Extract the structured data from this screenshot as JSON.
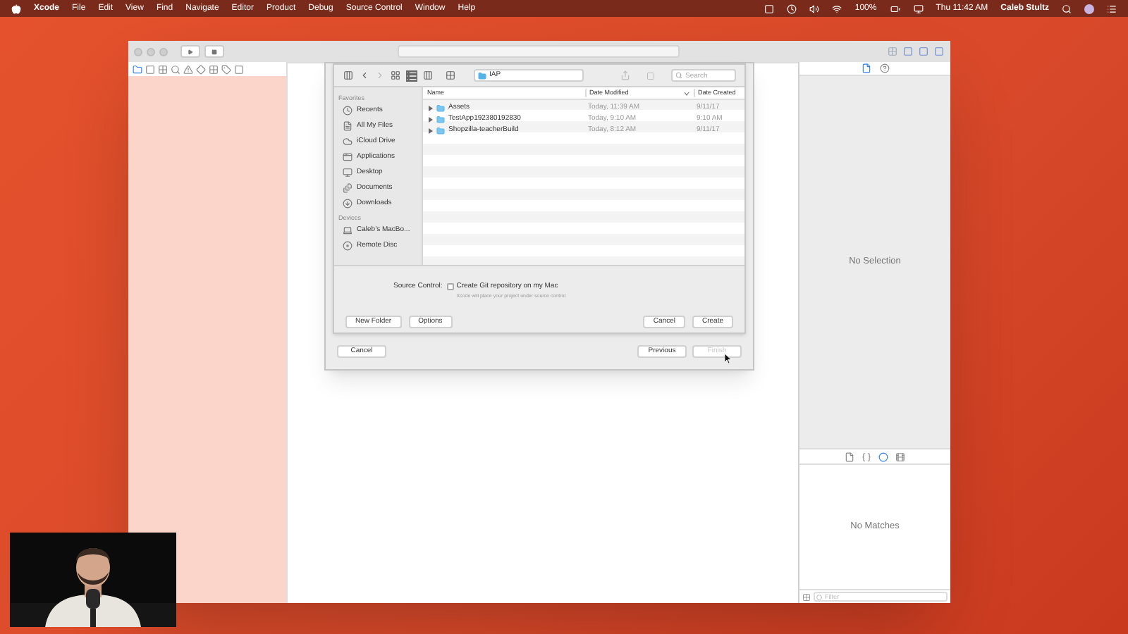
{
  "menu_bar": {
    "app": "Xcode",
    "menus": [
      "File",
      "Edit",
      "View",
      "Find",
      "Navigate",
      "Editor",
      "Product",
      "Debug",
      "Source Control",
      "Window",
      "Help"
    ],
    "battery": "100%",
    "clock": "Thu 11:42 AM",
    "user": "Caleb Stultz"
  },
  "navigator_tabs": [
    {
      "kind": "folder",
      "selected": true
    },
    {
      "kind": "square",
      "selected": false
    },
    {
      "kind": "grid",
      "selected": false
    },
    {
      "kind": "search",
      "selected": false
    },
    {
      "kind": "warning",
      "selected": false
    },
    {
      "kind": "diamond",
      "selected": false
    },
    {
      "kind": "grid",
      "selected": false
    },
    {
      "kind": "tag",
      "selected": false
    },
    {
      "kind": "square",
      "selected": false
    }
  ],
  "save_panel": {
    "location": "IAP",
    "search": {
      "placeholder": "Search"
    },
    "sidebar": [
      {
        "heading": "Favorites",
        "items": [
          {
            "label": "Recents",
            "kind": "recents"
          },
          {
            "label": "All My Files",
            "kind": "files"
          },
          {
            "label": "iCloud Drive",
            "kind": "cloud"
          },
          {
            "label": "Applications",
            "kind": "apps"
          },
          {
            "label": "Desktop",
            "kind": "desktop"
          },
          {
            "label": "Documents",
            "kind": "documents"
          },
          {
            "label": "Downloads",
            "kind": "downloads"
          }
        ]
      },
      {
        "heading": "Devices",
        "items": [
          {
            "label": "Caleb’s MacBo...",
            "kind": "laptop"
          },
          {
            "label": "Remote Disc",
            "kind": "disc"
          }
        ]
      }
    ],
    "columns": [
      "Name",
      "Date Modified",
      "Date Created"
    ],
    "rows": [
      {
        "name": "Assets",
        "modified": "Today, 11:39 AM",
        "created": "9/11/17",
        "expanded": false
      },
      {
        "name": "TestApp192380192830",
        "modified": "Today, 9:10 AM",
        "created": "9:10 AM",
        "expanded": false
      },
      {
        "name": "Shopzilla-teacherBuild",
        "modified": "Today, 8:12 AM",
        "created": "9/11/17",
        "expanded": false
      }
    ],
    "source_control": {
      "label": "Source Control:",
      "option": "Create Git repository on my Mac",
      "checked": false,
      "hint": "Xcode will place your project under source control"
    },
    "left_buttons": [
      "New Folder",
      "Options"
    ],
    "right_buttons": [
      {
        "label": "Cancel",
        "default": false
      },
      {
        "label": "Create",
        "default": false
      }
    ]
  },
  "sheet_buttons": [
    {
      "label": "Cancel",
      "disabled": false
    },
    {
      "label": "Previous",
      "disabled": false
    },
    {
      "label": "Finish",
      "disabled": true
    }
  ],
  "inspector": {
    "tabs": [
      {
        "kind": "file",
        "selected": true
      },
      {
        "kind": "help",
        "selected": false
      }
    ],
    "empty": "No Selection"
  },
  "library": {
    "tabs": [
      {
        "kind": "file",
        "selected": false
      },
      {
        "kind": "braces",
        "selected": false
      },
      {
        "kind": "circle",
        "selected": true
      },
      {
        "kind": "film",
        "selected": false
      }
    ],
    "empty": "No Matches",
    "filter": {
      "placeholder": "Filter"
    }
  }
}
